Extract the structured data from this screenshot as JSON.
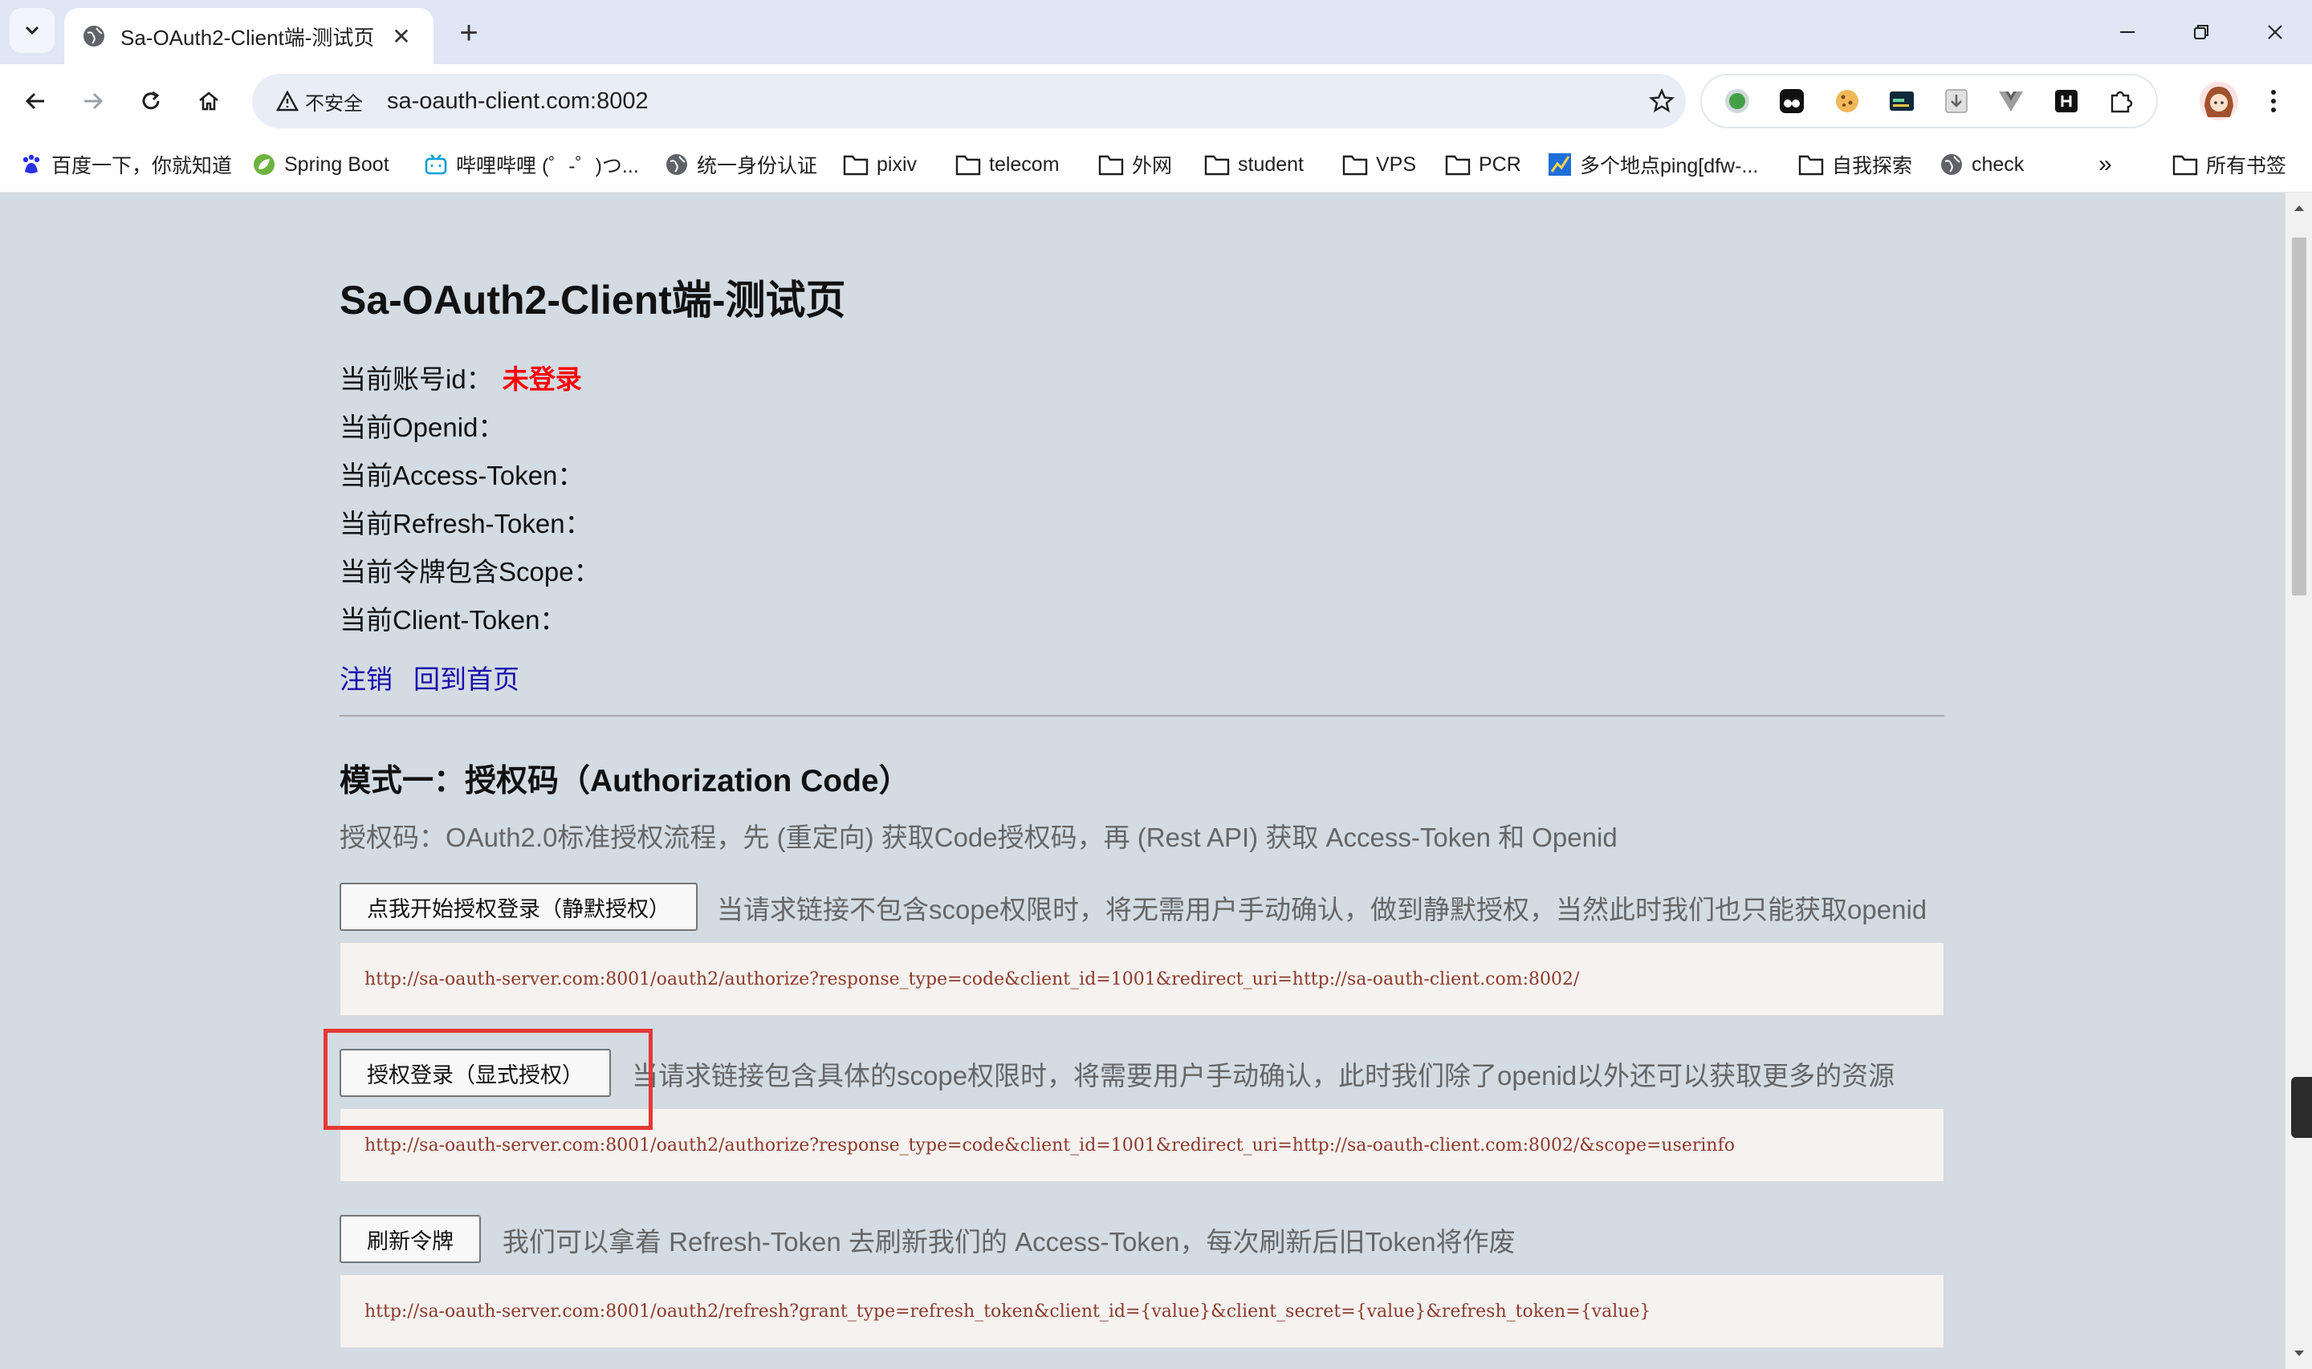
{
  "browser": {
    "tab": {
      "title": "Sa-OAuth2-Client端-测试页"
    },
    "address": {
      "security_label": "不安全",
      "url": "sa-oauth-client.com:8002"
    },
    "bookmarks": [
      {
        "label": "百度一下，你就知道",
        "icon": "baidu-icon"
      },
      {
        "label": "Spring Boot",
        "icon": "spring-icon"
      },
      {
        "label": "哔哩哔哩 (゜-゜)つ...",
        "icon": "bilibili-icon"
      },
      {
        "label": "统一身份认证",
        "icon": "globe-icon"
      },
      {
        "label": "pixiv",
        "icon": "folder-icon"
      },
      {
        "label": "telecom",
        "icon": "folder-icon"
      },
      {
        "label": "外网",
        "icon": "folder-icon"
      },
      {
        "label": "student",
        "icon": "folder-icon"
      },
      {
        "label": "VPS",
        "icon": "folder-icon"
      },
      {
        "label": "PCR",
        "icon": "folder-icon"
      },
      {
        "label": "多个地点ping[dfw-...",
        "icon": "chart-icon"
      },
      {
        "label": "自我探索",
        "icon": "folder-icon"
      },
      {
        "label": "check",
        "icon": "globe-icon"
      }
    ],
    "bookmarks_overflow": "»",
    "all_bookmarks": "所有书签"
  },
  "page": {
    "title": "Sa-OAuth2-Client端-测试页",
    "account_label": "当前账号id：",
    "account_value": "未登录",
    "openid_label": "当前Openid：",
    "access_token_label": "当前Access-Token：",
    "refresh_token_label": "当前Refresh-Token：",
    "scope_label": "当前令牌包含Scope：",
    "client_token_label": "当前Client-Token：",
    "logout_link": "注销",
    "home_link": "回到首页",
    "section1": {
      "title": "模式一：授权码（Authorization Code）",
      "desc": "授权码：OAuth2.0标准授权流程，先 (重定向) 获取Code授权码，再 (Rest API) 获取 Access-Token 和 Openid",
      "silent_button": "点我开始授权登录（静默授权）",
      "silent_note": "当请求链接不包含scope权限时，将无需用户手动确认，做到静默授权，当然此时我们也只能获取openid",
      "silent_url": "http://sa-oauth-server.com:8001/oauth2/authorize?response_type=code&client_id=1001&redirect_uri=http://sa-oauth-client.com:8002/",
      "explicit_button": "授权登录（显式授权）",
      "explicit_note": "当请求链接包含具体的scope权限时，将需要用户手动确认，此时我们除了openid以外还可以获取更多的资源",
      "explicit_url": "http://sa-oauth-server.com:8001/oauth2/authorize?response_type=code&client_id=1001&redirect_uri=http://sa-oauth-client.com:8002/&scope=userinfo",
      "refresh_button": "刷新令牌",
      "refresh_note": "我们可以拿着 Refresh-Token 去刷新我们的 Access-Token，每次刷新后旧Token将作废",
      "refresh_url": "http://sa-oauth-server.com:8001/oauth2/refresh?grant_type=refresh_token&client_id={value}&client_secret={value}&refresh_token={value}"
    }
  },
  "colors": {
    "page_bg": "#d3dbe3",
    "link": "#1a0dab",
    "not_logged_in": "#ff0000",
    "highlight": "#e53935",
    "code_text": "#8b3a2a"
  }
}
